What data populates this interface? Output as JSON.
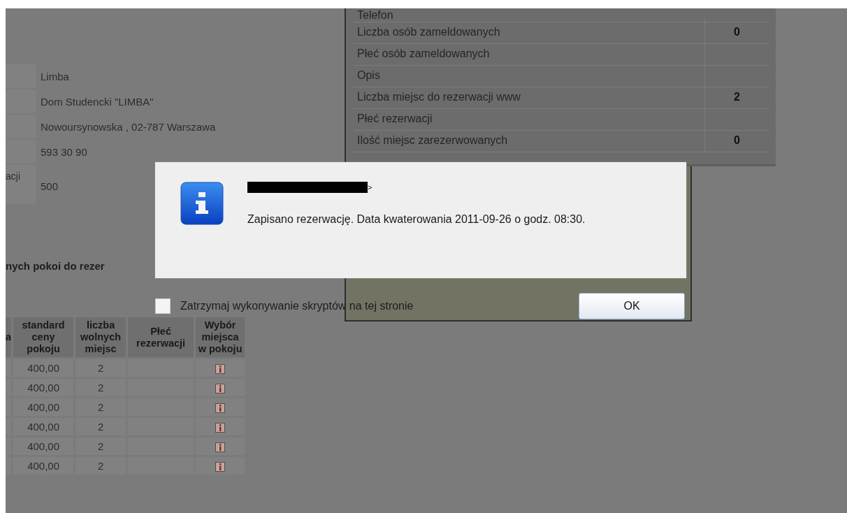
{
  "details": [
    {
      "value": "Limba"
    },
    {
      "value": "Dom Studencki \"LIMBA\""
    },
    {
      "value": "Nowoursynowska , 02-787 Warszawa"
    },
    {
      "value": "593 30 90"
    },
    {
      "label": "acji",
      "value": "500"
    }
  ],
  "room_panel": {
    "rows": [
      {
        "label": "Telefon"
      },
      {
        "label": "Liczba osób zameldowanych",
        "value": "0"
      },
      {
        "label": "Płeć osób zameldowanych"
      },
      {
        "label": "Opis"
      },
      {
        "label": "Liczba miejsc do rezerwacji www",
        "value": "2"
      },
      {
        "label": "Płeć rezerwacji"
      },
      {
        "label": "Ilość miejsc zarezerwowanych",
        "value": "0"
      }
    ]
  },
  "rooms_heading": "nych pokoi do rezer",
  "rooms_table": {
    "columns": [
      "a",
      "standard ceny pokoju",
      "liczba wolnych miejsc",
      "Płeć rezerwacji",
      "Wybór miejsca w pokoju"
    ],
    "rows": [
      {
        "price": "400,00",
        "free": "2"
      },
      {
        "price": "400,00",
        "free": "2"
      },
      {
        "price": "400,00",
        "free": "2"
      },
      {
        "price": "400,00",
        "free": "2"
      },
      {
        "price": "400,00",
        "free": "2"
      },
      {
        "price": "400,00",
        "free": "2"
      }
    ]
  },
  "dialog": {
    "title_suffix": ">",
    "message": "Zapisano rezerwację. Data kwaterowania 2011-09-26 o godz. 08:30.",
    "stop_scripts": {
      "label": "Zatrzymaj wykonywanie skryptów na tej stronie",
      "checked": false
    },
    "ok_button": "OK"
  }
}
